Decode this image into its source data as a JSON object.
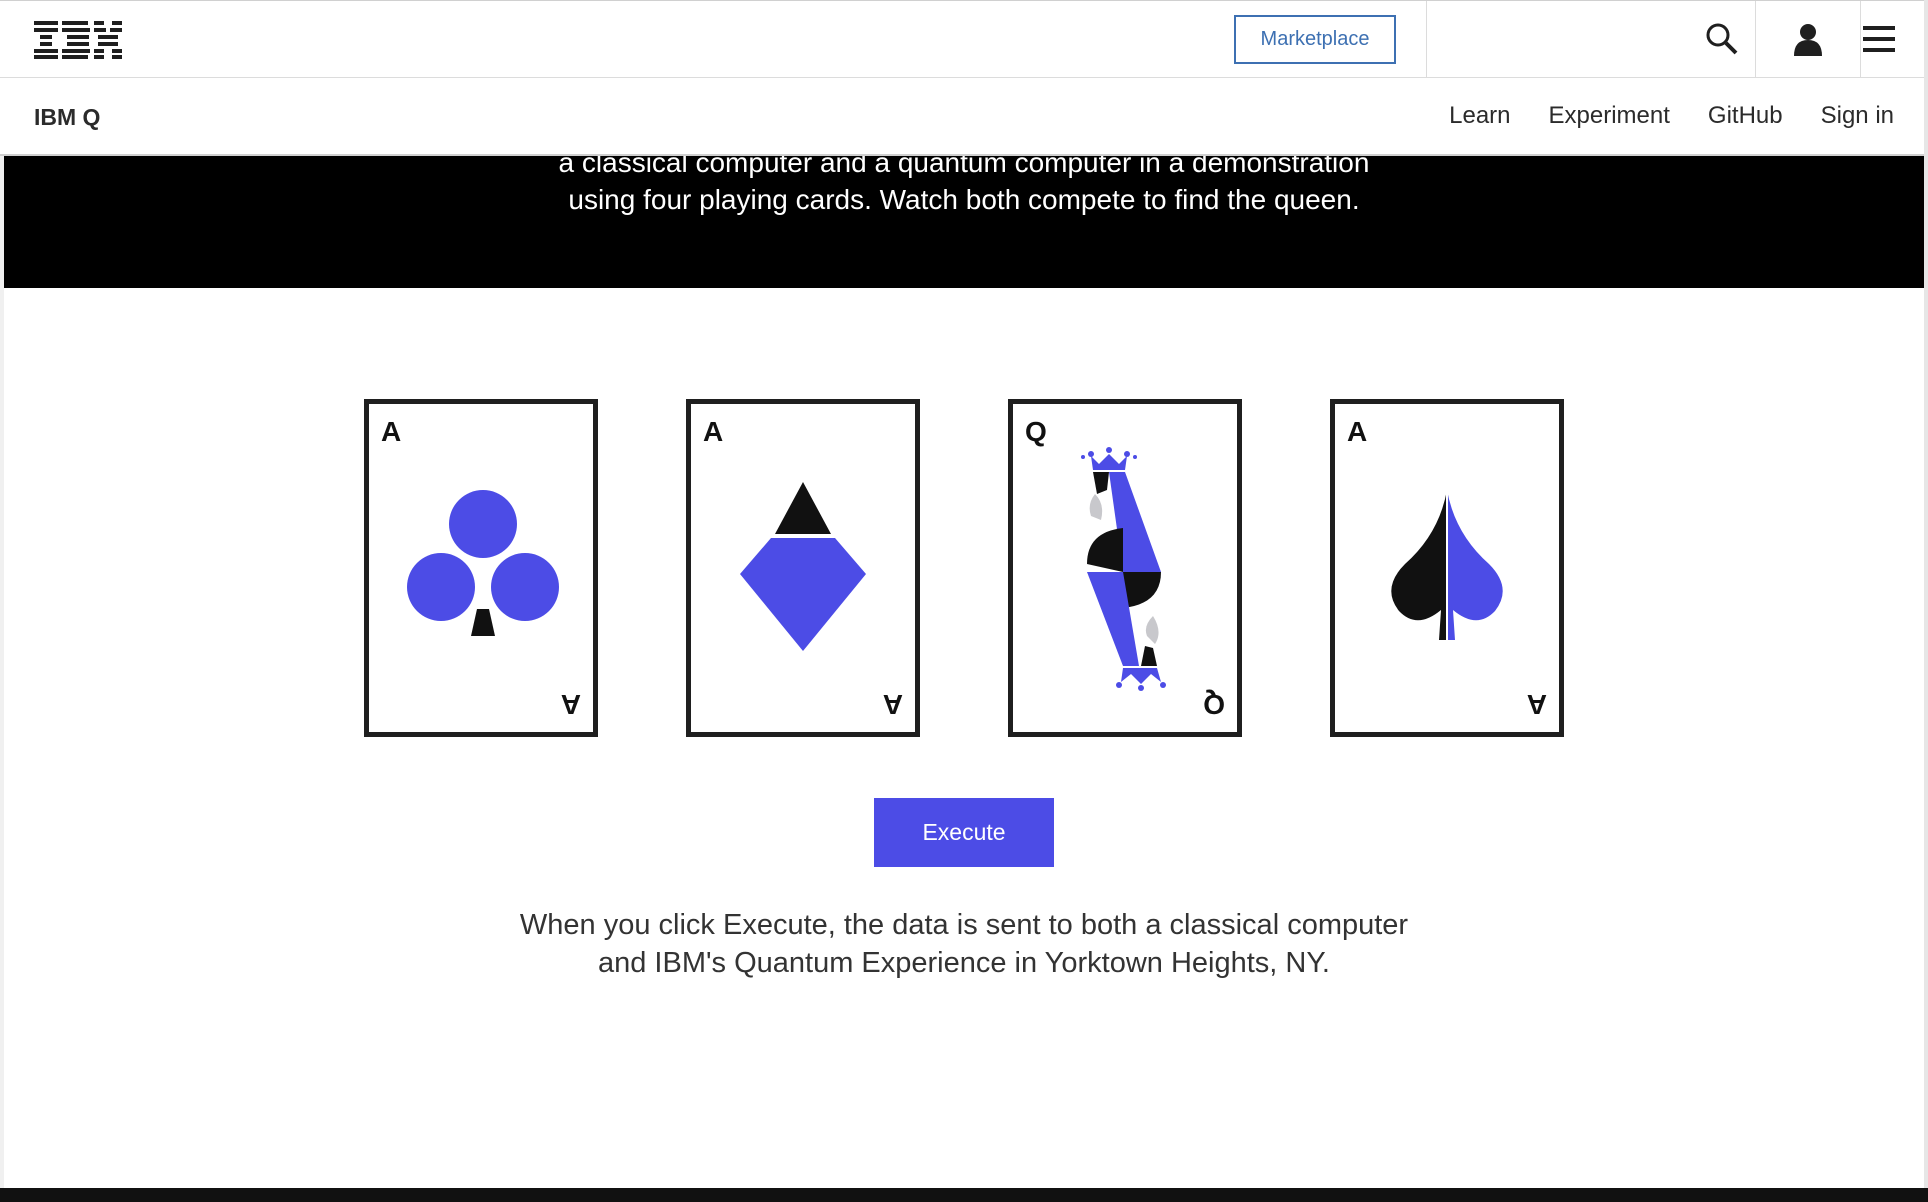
{
  "masthead": {
    "logo_text": "IBM",
    "marketplace_label": "Marketplace",
    "icons": [
      "search-icon",
      "user-icon",
      "menu-icon"
    ]
  },
  "subnav": {
    "brand": "IBM Q",
    "links": [
      "Learn",
      "Experiment",
      "GitHub",
      "Sign in"
    ]
  },
  "hero": {
    "line1": "a classical computer and a quantum computer in a demonstration",
    "line2": "using four playing cards. Watch both compete to find the queen."
  },
  "cards": [
    {
      "rank": "A",
      "suit": "clubs"
    },
    {
      "rank": "A",
      "suit": "diamonds"
    },
    {
      "rank": "Q",
      "suit": "queen"
    },
    {
      "rank": "A",
      "suit": "spades"
    }
  ],
  "execute_label": "Execute",
  "description": {
    "line1": "When you click Execute, the data is sent to both a classical computer",
    "line2": "and IBM's Quantum Experience in Yorktown Heights, NY."
  },
  "colors": {
    "accent": "#4c4ce6",
    "link_blue": "#3d70b2",
    "hero_bg": "#000000"
  }
}
